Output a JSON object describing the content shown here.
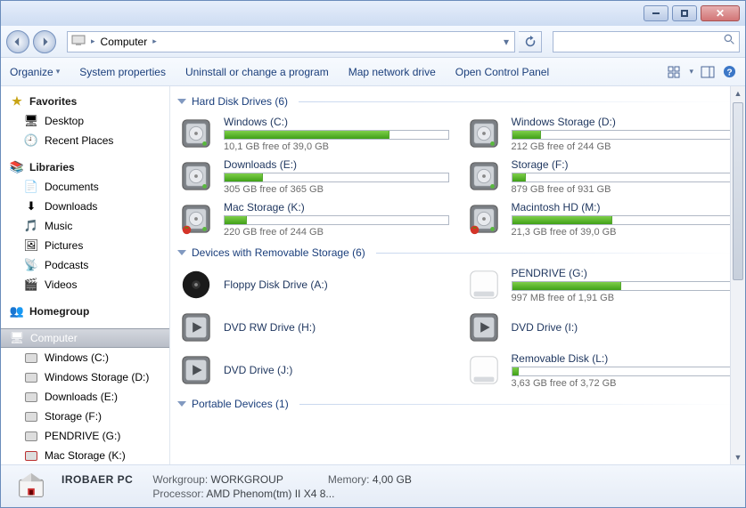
{
  "address": {
    "location": "Computer",
    "separator": "▸"
  },
  "toolbar": {
    "organize": "Organize",
    "sysprops": "System properties",
    "uninstall": "Uninstall or change a program",
    "mapdrive": "Map network drive",
    "controlpanel": "Open Control Panel"
  },
  "sidebar": {
    "favorites": {
      "label": "Favorites",
      "items": [
        {
          "label": "Desktop",
          "icon": "desktop"
        },
        {
          "label": "Recent Places",
          "icon": "recent"
        }
      ]
    },
    "libraries": {
      "label": "Libraries",
      "items": [
        {
          "label": "Documents",
          "icon": "doc"
        },
        {
          "label": "Downloads",
          "icon": "down"
        },
        {
          "label": "Music",
          "icon": "music"
        },
        {
          "label": "Pictures",
          "icon": "pic"
        },
        {
          "label": "Podcasts",
          "icon": "pod"
        },
        {
          "label": "Videos",
          "icon": "vid"
        }
      ]
    },
    "homegroup": {
      "label": "Homegroup"
    },
    "computer": {
      "label": "Computer",
      "items": [
        {
          "label": "Windows (C:)"
        },
        {
          "label": "Windows Storage (D:)"
        },
        {
          "label": "Downloads (E:)"
        },
        {
          "label": "Storage (F:)"
        },
        {
          "label": "PENDRIVE (G:)"
        },
        {
          "label": "Mac Storage (K:)"
        }
      ]
    }
  },
  "sections": {
    "hdd": {
      "title": "Hard Disk Drives (6)",
      "drives": [
        {
          "name": "Windows (C:)",
          "free": "10,1 GB free of 39,0 GB",
          "pct": 74,
          "mac": false
        },
        {
          "name": "Windows Storage (D:)",
          "free": "212 GB free of 244 GB",
          "pct": 13,
          "mac": false
        },
        {
          "name": "Downloads (E:)",
          "free": "305 GB free of 365 GB",
          "pct": 17,
          "mac": false
        },
        {
          "name": "Storage (F:)",
          "free": "879 GB free of 931 GB",
          "pct": 6,
          "mac": false
        },
        {
          "name": "Mac Storage (K:)",
          "free": "220 GB free of 244 GB",
          "pct": 10,
          "mac": true
        },
        {
          "name": "Macintosh HD (M:)",
          "free": "21,3 GB free of 39,0 GB",
          "pct": 45,
          "mac": true
        }
      ]
    },
    "removable": {
      "title": "Devices with Removable Storage (6)",
      "drives": [
        {
          "name": "Floppy Disk Drive (A:)",
          "free": "",
          "pct": null,
          "icon": "floppy"
        },
        {
          "name": "PENDRIVE (G:)",
          "free": "997 MB free of 1,91 GB",
          "pct": 49,
          "icon": "usb"
        },
        {
          "name": "DVD RW Drive (H:)",
          "free": "",
          "pct": null,
          "icon": "dvd"
        },
        {
          "name": "DVD Drive (I:)",
          "free": "",
          "pct": null,
          "icon": "dvd"
        },
        {
          "name": "DVD Drive (J:)",
          "free": "",
          "pct": null,
          "icon": "dvd"
        },
        {
          "name": "Removable Disk (L:)",
          "free": "3,63 GB free of 3,72 GB",
          "pct": 3,
          "icon": "usb"
        }
      ]
    },
    "portable": {
      "title": "Portable Devices (1)"
    }
  },
  "status": {
    "name": "IROBAER PC",
    "workgroup_label": "Workgroup:",
    "workgroup": "WORKGROUP",
    "memory_label": "Memory:",
    "memory": "4,00 GB",
    "processor_label": "Processor:",
    "processor": "AMD Phenom(tm) II X4 8..."
  }
}
